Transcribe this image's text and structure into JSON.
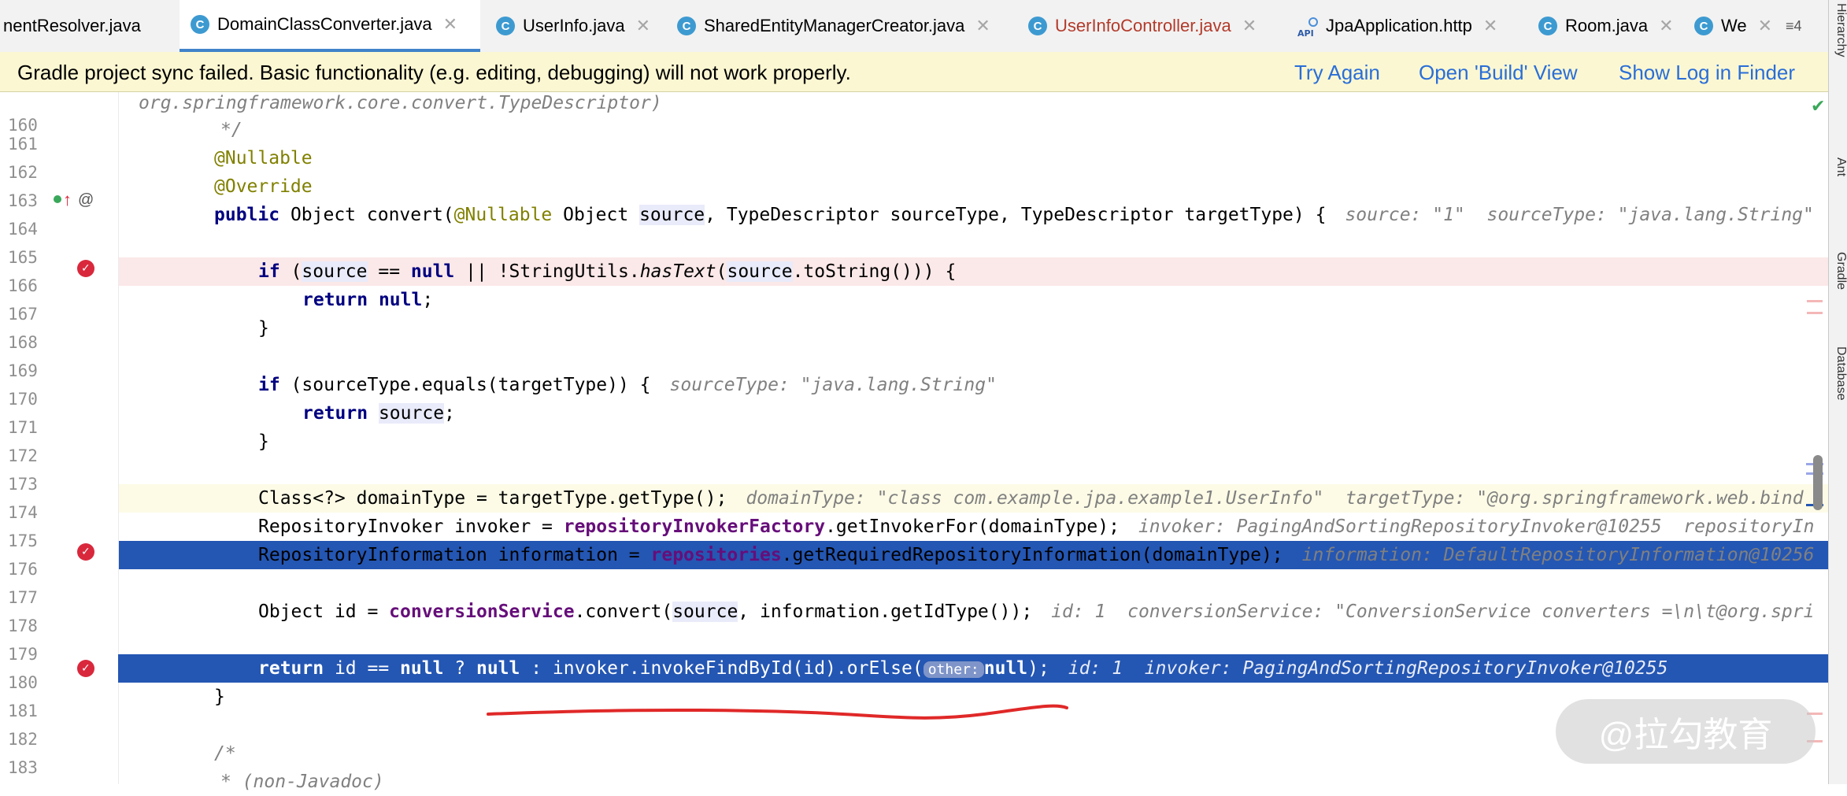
{
  "tabs": [
    {
      "label": "nentResolver.java",
      "icon": "none"
    },
    {
      "label": "DomainClassConverter.java",
      "icon": "c",
      "active": true
    },
    {
      "label": "UserInfo.java",
      "icon": "c"
    },
    {
      "label": "SharedEntityManagerCreator.java",
      "icon": "c"
    },
    {
      "label": "UserInfoController.java",
      "icon": "c"
    },
    {
      "label": "JpaApplication.http",
      "icon": "api"
    },
    {
      "label": "Room.java",
      "icon": "c"
    },
    {
      "label": "We",
      "icon": "c"
    }
  ],
  "tab_overflow": "≡4",
  "banner": {
    "message": "Gradle project sync failed. Basic functionality (e.g. editing, debugging) will not work properly.",
    "try_again": "Try Again",
    "open_build": "Open 'Build' View",
    "show_log": "Show Log in Finder"
  },
  "right_strip": {
    "hierarchy": "Hierarchy",
    "ant": "Ant",
    "gradle": "Gradle",
    "database": "Database"
  },
  "editor": {
    "top_fragment": "org.springframework.core.convert.TypeDescriptor)",
    "line_numbers": [
      "160",
      "161",
      "162",
      "163",
      "164",
      "165",
      "166",
      "167",
      "168",
      "169",
      "170",
      "171",
      "172",
      "173",
      "174",
      "175",
      "176",
      "177",
      "178",
      "179",
      "180",
      "181",
      "182",
      "183"
    ],
    "lines": {
      "l160": "*/",
      "l161": "@Nullable",
      "l162": "@Override",
      "l163_kw": "public",
      "l163_a": " Object convert(",
      "l163_ann": "@Nullable",
      "l163_b": " Object ",
      "l163_var": "source",
      "l163_c": ", TypeDescriptor sourceType, TypeDescriptor targetType) {",
      "l163_inline": "source: \"1\"  sourceType: \"java.lang.String\"",
      "l165_kw1": "if",
      "l165_a": " (",
      "l165_var": "source",
      "l165_b": " == ",
      "l165_kw2": "null",
      "l165_c": " || !StringUtils.",
      "l165_it": "hasText",
      "l165_d": "(",
      "l165_var2": "source",
      "l165_e": ".toString())) {",
      "l166_kw": "return",
      "l166_kw2": "null",
      "l166_a": ";",
      "l167": "}",
      "l169_kw": "if",
      "l169_a": " (sourceType.equals(targetType)) {",
      "l169_inline": "sourceType: \"java.lang.String\"",
      "l170_kw": "return",
      "l170_var": "source",
      "l170_a": ";",
      "l171": "}",
      "l173_a": "Class<?> domainType = targetType.getType();",
      "l173_inline": "domainType: \"class com.example.jpa.example1.UserInfo\"  targetType: \"@org.springframework.web.bind",
      "l174_a": "RepositoryInvoker invoker = ",
      "l174_fld": "repositoryInvokerFactory",
      "l174_b": ".getInvokerFor(domainType);",
      "l174_inline": "invoker: PagingAndSortingRepositoryInvoker@10255  repositoryIn",
      "l175_a": "RepositoryInformation information = ",
      "l175_fld": "repositories",
      "l175_b": ".getRequiredRepositoryInformation(domainType);",
      "l175_inline": "information: DefaultRepositoryInformation@10256",
      "l177_a": "Object id = ",
      "l177_fld": "conversionService",
      "l177_b": ".convert(",
      "l177_var": "source",
      "l177_c": ", information.getIdType());",
      "l177_inline": "id: 1  conversionService: \"ConversionService converters =\\n\\t@org.spri",
      "l179_kw": "return",
      "l179_a": " id == ",
      "l179_kw2": "null",
      "l179_b": " ? ",
      "l179_kw3": "null",
      "l179_c": " : invoker.invokeFindById(id).orElse(",
      "l179_hint": "other:",
      "l179_kw4": "null",
      "l179_d": ");",
      "l179_inline": "id: 1  invoker: PagingAndSortingRepositoryInvoker@10255",
      "l180": "}",
      "l182": "/*",
      "l183": "* (non-Javadoc)"
    }
  },
  "gutter_marks": {
    "l163_icon": "@",
    "bp_check": "✓"
  },
  "watermark": "@拉勾教育",
  "colors": {
    "accent": "#2a6ed8",
    "banner_bg": "#fbf7d2",
    "execution_line": "#2456b3",
    "breakpoint_line": "#fbe8e8",
    "annotation_stroke": "#e02828"
  }
}
